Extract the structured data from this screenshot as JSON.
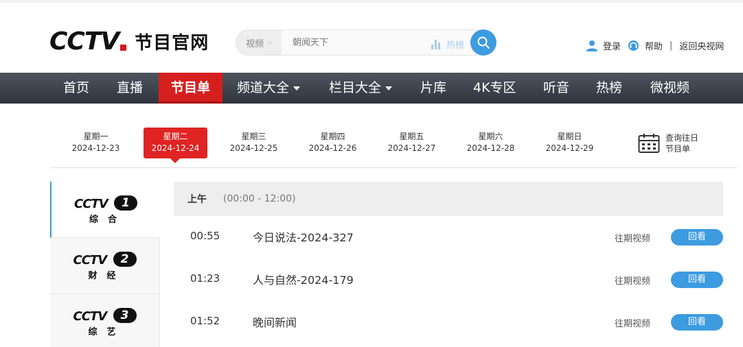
{
  "header": {
    "logo_text": "CCTV",
    "logo_sub": "节目官网",
    "search": {
      "category": "视频",
      "placeholder": "朝闻天下",
      "hot_label": "热榜"
    },
    "links": {
      "login": "登录",
      "help": "帮助",
      "separator": "|",
      "back": "返回央视网"
    }
  },
  "nav": {
    "items": [
      {
        "label": "首页"
      },
      {
        "label": "直播"
      },
      {
        "label": "节目单"
      },
      {
        "label": "频道大全"
      },
      {
        "label": "栏目大全"
      },
      {
        "label": "片库"
      },
      {
        "label": "4K专区"
      },
      {
        "label": "听音"
      },
      {
        "label": "热榜"
      },
      {
        "label": "微视频"
      }
    ]
  },
  "days": [
    {
      "weekday": "星期一",
      "date": "2024-12-23"
    },
    {
      "weekday": "星期二",
      "date": "2024-12-24"
    },
    {
      "weekday": "星期三",
      "date": "2024-12-25"
    },
    {
      "weekday": "星期四",
      "date": "2024-12-26"
    },
    {
      "weekday": "星期五",
      "date": "2024-12-27"
    },
    {
      "weekday": "星期六",
      "date": "2024-12-28"
    },
    {
      "weekday": "星期日",
      "date": "2024-12-29"
    }
  ],
  "history": {
    "line1": "查询往日",
    "line2": "节目单"
  },
  "channels": [
    {
      "logo": "CCTV",
      "num": "1",
      "name": "综合"
    },
    {
      "logo": "CCTV",
      "num": "2",
      "name": "财经"
    },
    {
      "logo": "CCTV",
      "num": "3",
      "name": "综艺"
    }
  ],
  "schedule": {
    "period_label": "上午",
    "period_range": "(00:00 - 12:00)",
    "programs": [
      {
        "time": "00:55",
        "title": "今日说法-2024-327",
        "past": "往期视频",
        "replay": "回看"
      },
      {
        "time": "01:23",
        "title": "人与自然-2024-179",
        "past": "往期视频",
        "replay": "回看"
      },
      {
        "time": "01:52",
        "title": "晚间新闻",
        "past": "往期视频",
        "replay": "回看"
      }
    ]
  },
  "colors": {
    "accent_red": "#e02424",
    "accent_blue": "#3d9be0",
    "nav_bg": "#3c424a"
  }
}
